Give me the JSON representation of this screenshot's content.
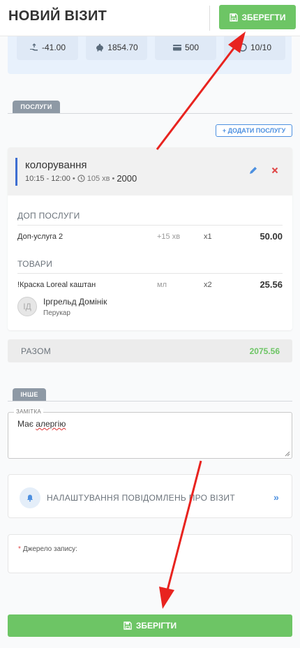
{
  "header": {
    "title": "НОВИЙ ВІЗИТ",
    "save_label": "ЗБЕРЕГТИ"
  },
  "stats": [
    {
      "icon": "payment-hand-icon",
      "value": "-41.00"
    },
    {
      "icon": "piggy-bank-icon",
      "value": "1854.70"
    },
    {
      "icon": "card-icon",
      "value": "500"
    },
    {
      "icon": "progress-icon",
      "value": "10/10"
    }
  ],
  "services": {
    "tab_label": "ПОСЛУГИ",
    "add_label": "+ ДОДАТИ ПОСЛУГУ",
    "item": {
      "name": "колорування",
      "time": "10:15 - 12:00",
      "sep1": "•",
      "duration": "105 хв",
      "sep2": "•",
      "price": "2000"
    },
    "extras_title": "ДОП ПОСЛУГИ",
    "extras": [
      {
        "name": "Доп-услуга 2",
        "duration": "+15 хв",
        "qty": "x1",
        "price": "50.00"
      }
    ],
    "goods_title": "ТОВАРИ",
    "goods": [
      {
        "name": "!Краска Loreal каштан",
        "unit": "мл",
        "qty": "x2",
        "price": "25.56"
      }
    ],
    "employee": {
      "initials": "ІД",
      "name": "Іргрельд Домінік",
      "role": "Перукар"
    }
  },
  "total": {
    "label": "РАЗОМ",
    "value": "2075.56"
  },
  "other": {
    "tab_label": "ІНШЕ",
    "note_legend": "ЗАМІТКА",
    "note_word1": "Має",
    "note_word2": "алергію"
  },
  "notifications": {
    "label": "НАЛАШТУВАННЯ ПОВІДОМЛЕНЬ ПРО ВІЗИТ",
    "chevron": "»"
  },
  "source": {
    "required_mark": "*",
    "label": "Джерело запису:"
  },
  "footer": {
    "save_label": "ЗБЕРІГТИ"
  },
  "colors": {
    "save_green": "#6dc565",
    "accent_blue": "#4d90e0",
    "delete_red": "#e04848",
    "annotation_arrow": "#e8231f"
  }
}
